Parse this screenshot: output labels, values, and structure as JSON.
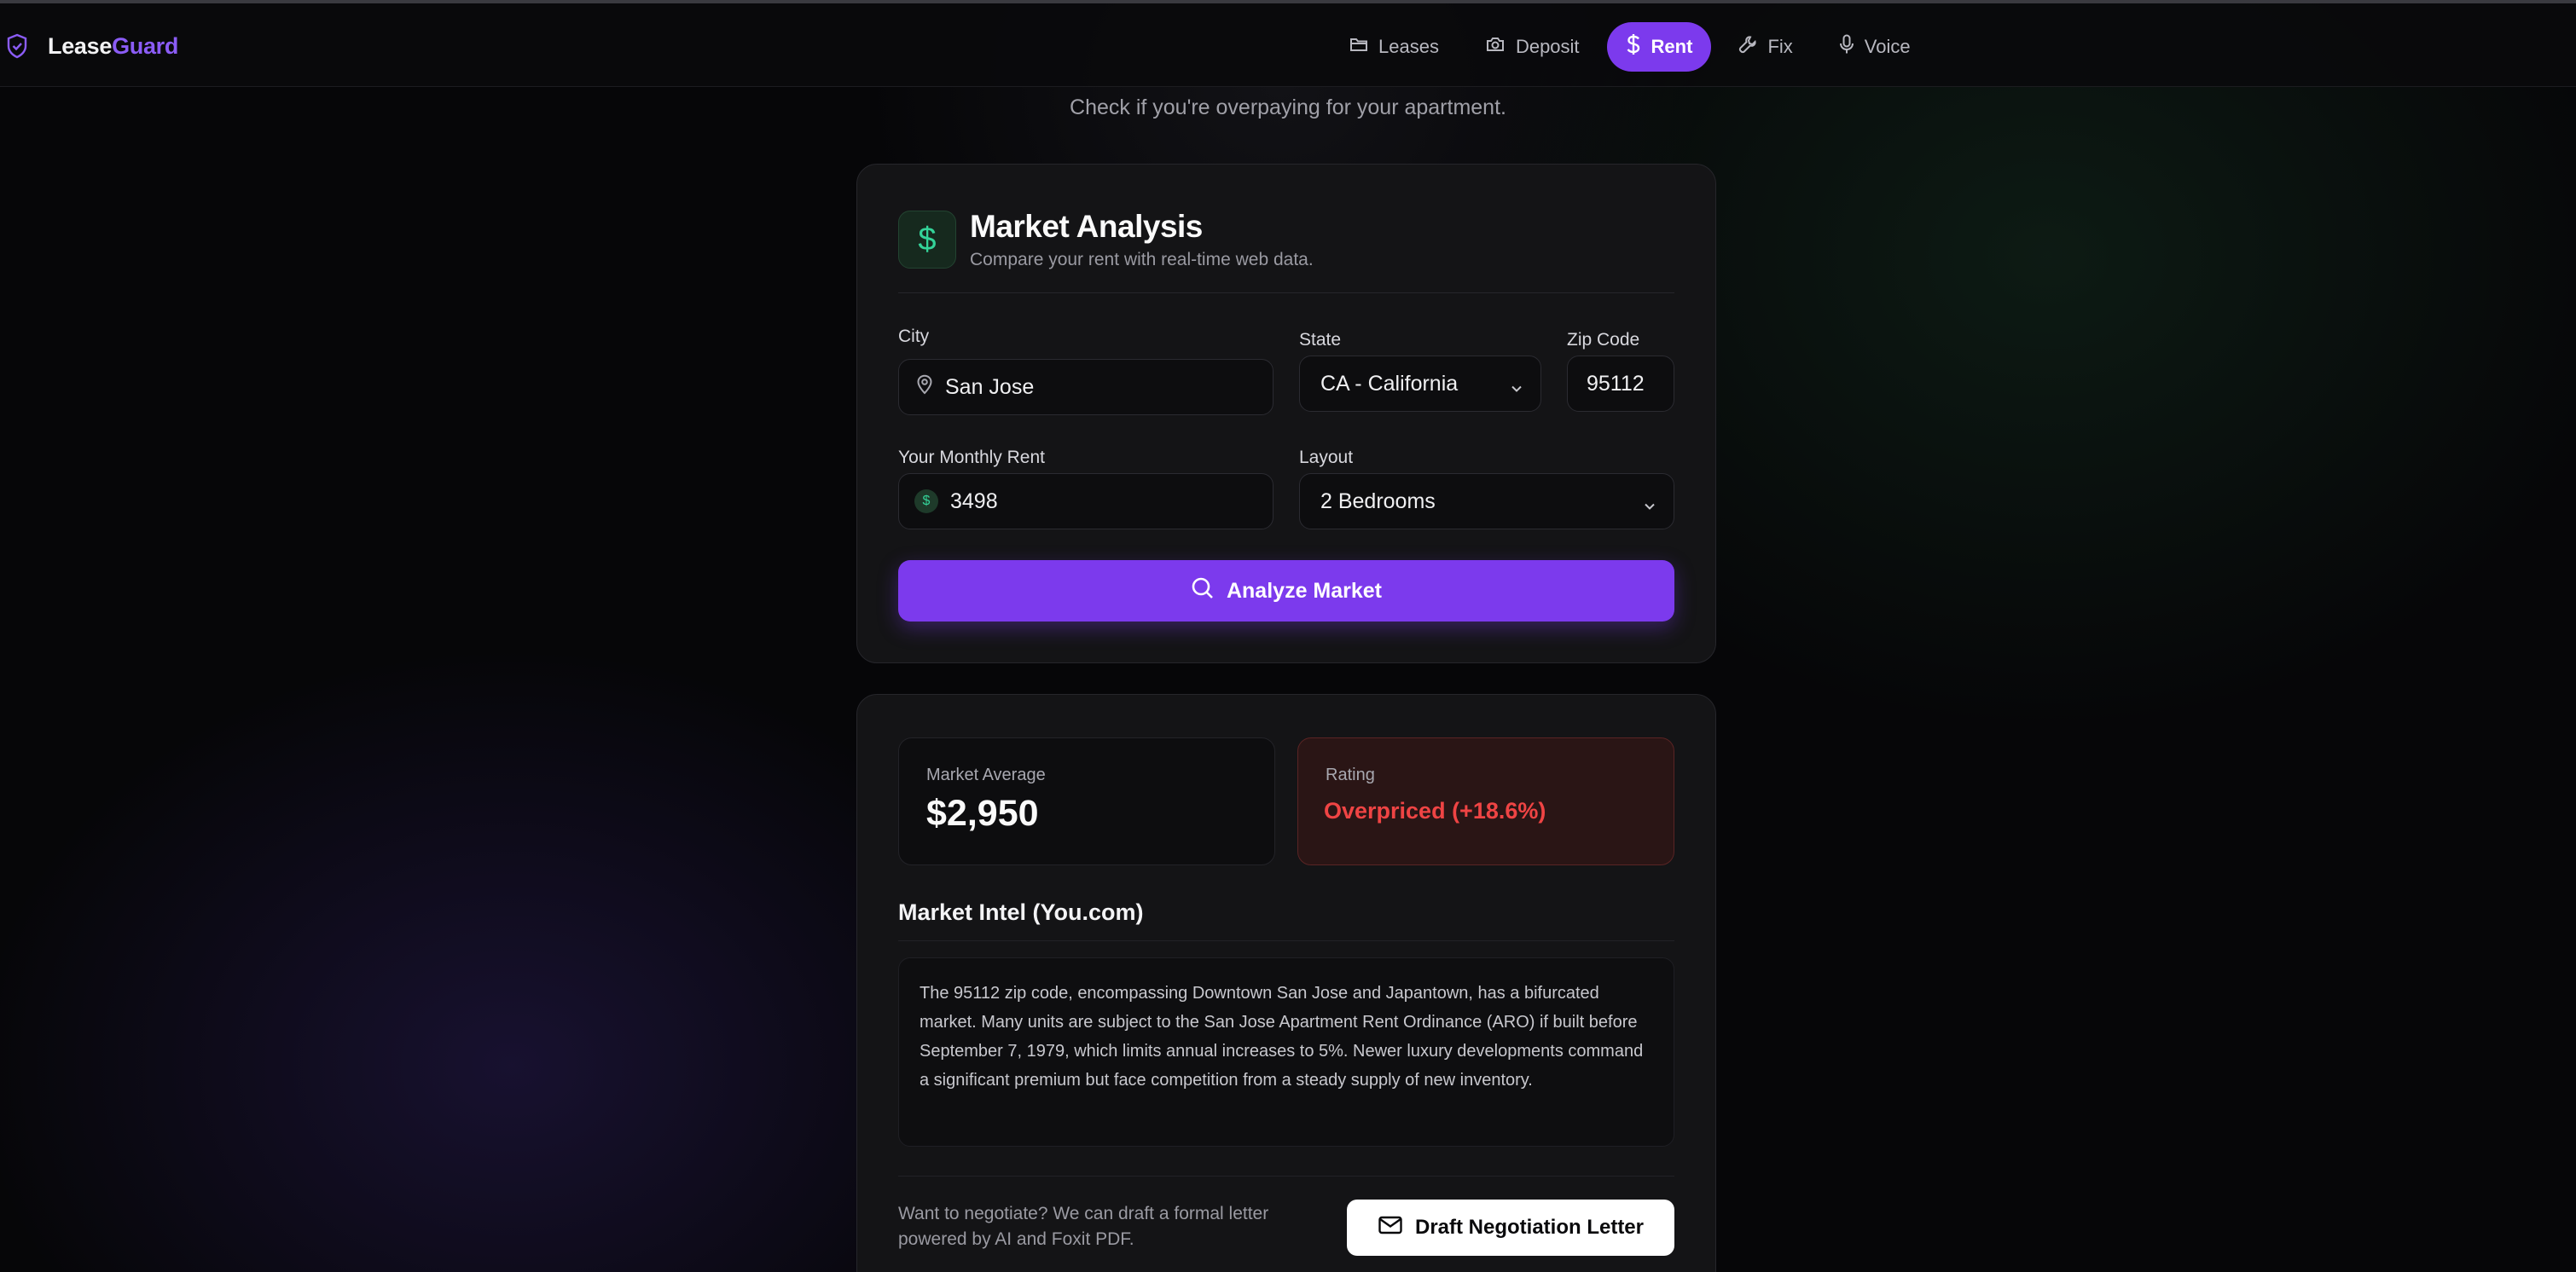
{
  "brand": {
    "name_part1": "Lease",
    "name_part2": "Guard"
  },
  "nav": {
    "items": [
      {
        "label": "Leases",
        "icon": "folder-icon",
        "active": false
      },
      {
        "label": "Deposit",
        "icon": "camera-icon",
        "active": false
      },
      {
        "label": "Rent",
        "icon": "dollar-icon",
        "active": true
      },
      {
        "label": "Fix",
        "icon": "wrench-icon",
        "active": false
      },
      {
        "label": "Voice",
        "icon": "microphone-icon",
        "active": false
      }
    ]
  },
  "page": {
    "subtitle": "Check if you're overpaying for your apartment."
  },
  "analysis": {
    "icon": "dollar-icon",
    "icon_glyph": "$",
    "title": "Market Analysis",
    "subtitle": "Compare your rent with real-time web data.",
    "city": {
      "label": "City",
      "value": "San Jose"
    },
    "state": {
      "label": "State",
      "value": "CA - California"
    },
    "zip": {
      "label": "Zip Code",
      "value": "95112"
    },
    "rent": {
      "label": "Your Monthly Rent",
      "value": "3498",
      "icon_glyph": "$"
    },
    "layout": {
      "label": "Layout",
      "value": "2 Bedrooms"
    },
    "analyze_button": "Analyze Market"
  },
  "results": {
    "market_average": {
      "label": "Market Average",
      "value": "$2,950"
    },
    "rating": {
      "label": "Rating",
      "value": "Overpriced (+18.6%)"
    },
    "intel_title": "Market Intel (You.com)",
    "intel_text": "The 95112 zip code, encompassing Downtown San Jose and Japantown, has a bifurcated market. Many units are subject to the San Jose Apartment Rent Ordinance (ARO) if built before September 7, 1979, which limits annual increases to 5%. Newer luxury developments command a significant premium but face competition from a steady supply of new inventory.",
    "negotiate_text": "Want to negotiate? We can draft a formal letter powered by AI and Foxit PDF.",
    "draft_button": "Draft Negotiation Letter"
  },
  "colors": {
    "accent": "#7c3aed",
    "brand_accent": "#8b5cf6",
    "money_green": "#34d399",
    "overpriced_red": "#ef4444"
  }
}
